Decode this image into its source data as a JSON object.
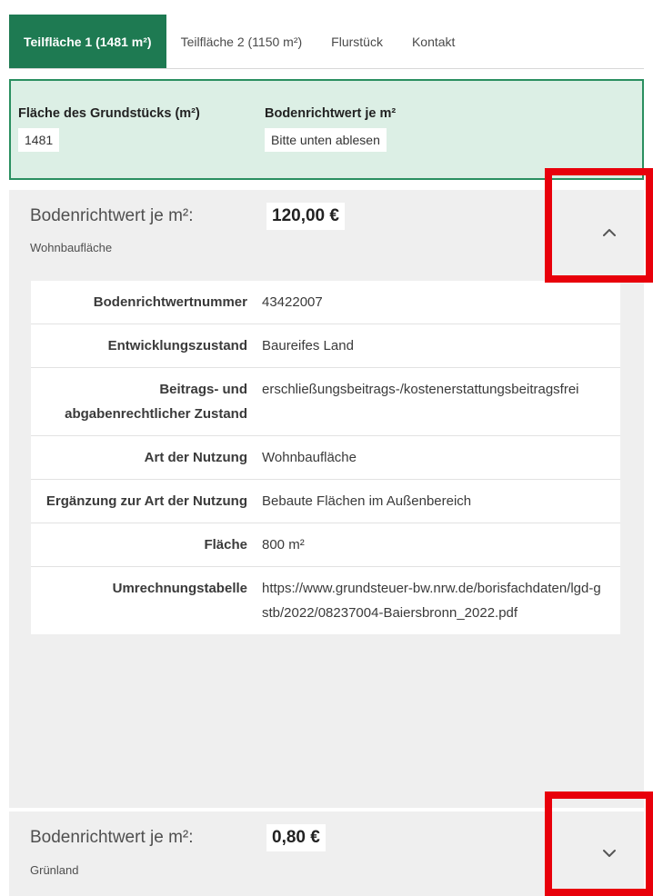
{
  "tabs": [
    {
      "label": "Teilfläche 1 (1481 m²)",
      "active": true
    },
    {
      "label": "Teilfläche 2 (1150 m²)",
      "active": false
    },
    {
      "label": "Flurstück",
      "active": false
    },
    {
      "label": "Kontakt",
      "active": false
    }
  ],
  "summary": {
    "area_label": "Fläche des Grundstücks (m²)",
    "area_value": "1481",
    "land_value_label": "Bodenrichtwert je m²",
    "land_value_value": "Bitte unten ablesen"
  },
  "panels": [
    {
      "label": "Bodenrichtwert je m²:",
      "value": "120,00 €",
      "sub": "Wohnbaufläche",
      "expanded": true,
      "chevron_icon": "chevron-up-icon",
      "rows": [
        {
          "key": "Bodenrichtwertnummer",
          "value": "43422007"
        },
        {
          "key": "Entwicklungszustand",
          "value": "Baureifes Land"
        },
        {
          "key": "Beitrags- und abgabenrechtlicher Zustand",
          "value": "erschließungsbeitrags-/kostenerstattungsbeitragsfrei"
        },
        {
          "key": "Art der Nutzung",
          "value": "Wohnbaufläche"
        },
        {
          "key": "Ergänzung zur Art der Nutzung",
          "value": "Bebaute Flächen im Außenbereich"
        },
        {
          "key": "Fläche",
          "value": "800 m²"
        },
        {
          "key": "Umrechnungstabelle",
          "value": "https://www.grundsteuer-bw.nrw.de/borisfachdaten/lgd-gstb/2022/08237004-Baiersbronn_2022.pdf"
        }
      ]
    },
    {
      "label": "Bodenrichtwert je m²:",
      "value": "0,80 €",
      "sub": "Grünland",
      "expanded": false,
      "chevron_icon": "chevron-down-icon"
    }
  ],
  "colors": {
    "active_tab": "#1e7a52",
    "summary_background": "#dcefe5",
    "summary_border": "#2a8f60",
    "panel_background": "#efefef",
    "highlight": "#e8000b"
  }
}
